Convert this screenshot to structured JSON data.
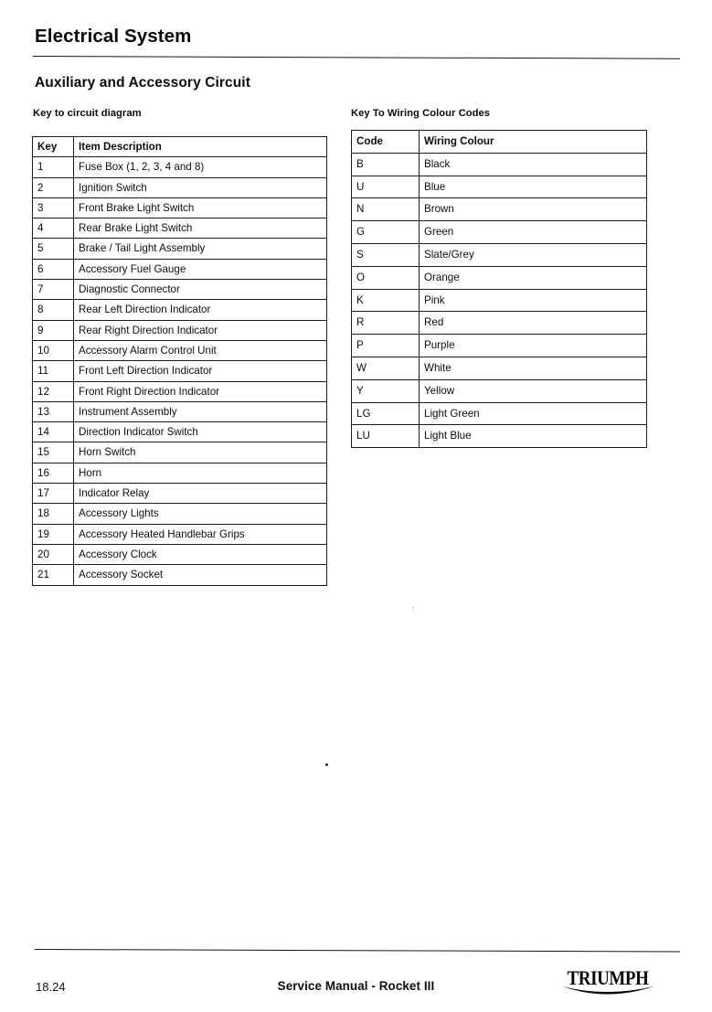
{
  "header": {
    "chapter_title": "Electrical System",
    "section_title": "Auxiliary and Accessory Circuit"
  },
  "key_table": {
    "caption": "Key to circuit diagram",
    "columns": [
      "Key",
      "Item Description"
    ],
    "rows": [
      [
        "1",
        "Fuse Box (1, 2, 3, 4 and 8)"
      ],
      [
        "2",
        "Ignition Switch"
      ],
      [
        "3",
        "Front Brake Light Switch"
      ],
      [
        "4",
        "Rear Brake Light Switch"
      ],
      [
        "5",
        "Brake / Tail Light Assembly"
      ],
      [
        "6",
        "Accessory Fuel Gauge"
      ],
      [
        "7",
        "Diagnostic Connector"
      ],
      [
        "8",
        "Rear Left Direction Indicator"
      ],
      [
        "9",
        "Rear Right Direction Indicator"
      ],
      [
        "10",
        "Accessory Alarm Control Unit"
      ],
      [
        "11",
        "Front Left Direction Indicator"
      ],
      [
        "12",
        "Front Right Direction Indicator"
      ],
      [
        "13",
        "Instrument Assembly"
      ],
      [
        "14",
        "Direction Indicator Switch"
      ],
      [
        "15",
        "Horn Switch"
      ],
      [
        "16",
        "Horn"
      ],
      [
        "17",
        "Indicator Relay"
      ],
      [
        "18",
        "Accessory Lights"
      ],
      [
        "19",
        "Accessory Heated Handlebar Grips"
      ],
      [
        "20",
        "Accessory Clock"
      ],
      [
        "21",
        "Accessory Socket"
      ]
    ]
  },
  "colour_table": {
    "caption": "Key To Wiring Colour Codes",
    "columns": [
      "Code",
      "Wiring Colour"
    ],
    "rows": [
      [
        "B",
        "Black"
      ],
      [
        "U",
        "Blue"
      ],
      [
        "N",
        "Brown"
      ],
      [
        "G",
        "Green"
      ],
      [
        "S",
        "Slate/Grey"
      ],
      [
        "O",
        "Orange"
      ],
      [
        "K",
        "Pink"
      ],
      [
        "R",
        "Red"
      ],
      [
        "P",
        "Purple"
      ],
      [
        "W",
        "White"
      ],
      [
        "Y",
        "Yellow"
      ],
      [
        "LG",
        "Light Green"
      ],
      [
        "LU",
        "Light Blue"
      ]
    ]
  },
  "footer": {
    "page_number": "18.24",
    "title": "Service Manual - Rocket III",
    "brand": "TRIUMPH"
  },
  "colors": {
    "ink": "#111111",
    "rule": "#151515",
    "paper": "#ffffff"
  }
}
